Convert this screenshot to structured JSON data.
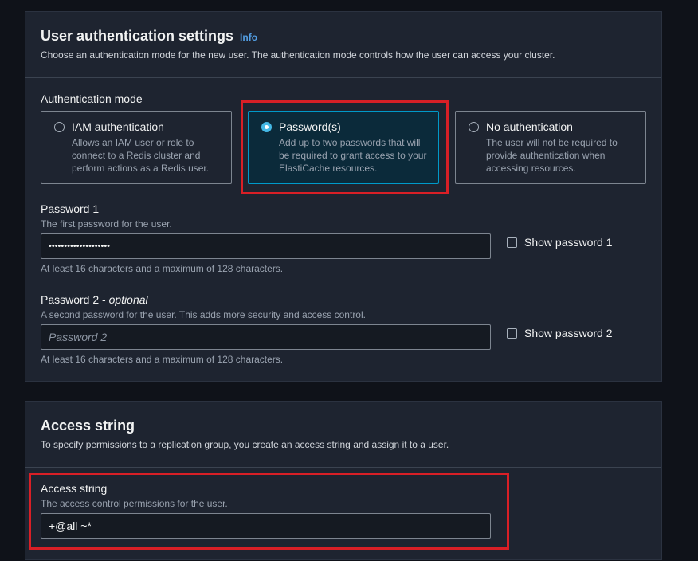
{
  "auth_panel": {
    "title": "User authentication settings",
    "info_link": "Info",
    "description": "Choose an authentication mode for the new user. The authentication mode controls how the user can access your cluster.",
    "mode_label": "Authentication mode",
    "modes": [
      {
        "title": "IAM authentication",
        "description": "Allows an IAM user or role to connect to a Redis cluster and perform actions as a Redis user.",
        "selected": false
      },
      {
        "title": "Password(s)",
        "description": "Add up to two passwords that will be required to grant access to your ElastiCache resources.",
        "selected": true
      },
      {
        "title": "No authentication",
        "description": "The user will not be required to provide authentication when accessing resources.",
        "selected": false
      }
    ],
    "password1": {
      "label": "Password 1",
      "description": "The first password for the user.",
      "value": "••••••••••••••••••••",
      "constraint": "At least 16 characters and a maximum of 128 characters.",
      "show_label": "Show password 1"
    },
    "password2": {
      "label": "Password 2 - ",
      "label_optional": "optional",
      "description": "A second password for the user. This adds more security and access control.",
      "placeholder": "Password 2",
      "constraint": "At least 16 characters and a maximum of 128 characters.",
      "show_label": "Show password 2"
    }
  },
  "access_panel": {
    "title": "Access string",
    "description": "To specify permissions to a replication group, you create an access string and assign it to a user.",
    "field_label": "Access string",
    "field_description": "The access control permissions for the user.",
    "value": "+@all ~*"
  },
  "colors": {
    "highlight": "#d91f26",
    "selected_border": "#0099c9",
    "info_link": "#539fe5"
  }
}
